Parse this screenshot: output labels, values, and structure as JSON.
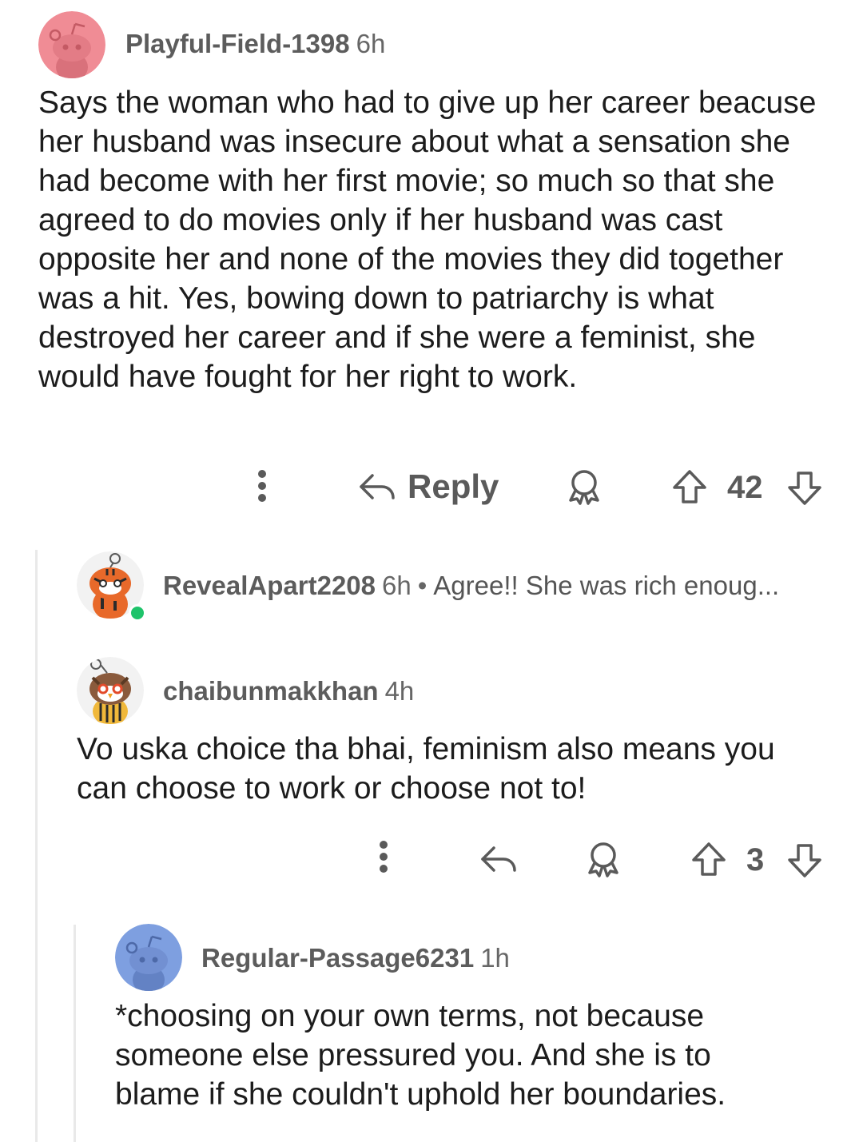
{
  "comments": [
    {
      "username": "Playful-Field-1398",
      "time": "6h",
      "avatar_icon": "snoo-avatar-pink",
      "body": "Says the woman who had to give up her career beacuse her husband was insecure about what a sensation she had become with her first movie; so much so that she agreed to do movies only if her husband was cast opposite her and none of the movies they did together was a hit. Yes, bowing down to patriarchy is what destroyed her career and if she were a feminist, she would have fought for her right to work.",
      "actions": {
        "more_icon": "more-vertical-icon",
        "reply_icon": "reply-arrow-icon",
        "reply_label": "Reply",
        "award_icon": "award-icon",
        "upvote_icon": "upvote-arrow-icon",
        "score": "42",
        "downvote_icon": "downvote-arrow-icon"
      }
    },
    {
      "username": "RevealApart2208",
      "time": "6h",
      "separator": "•",
      "preview": "Agree!! She was rich enoug...",
      "avatar_icon": "snoo-avatar-tiger",
      "online_color": "#1ec36a"
    },
    {
      "username": "chaibunmakkhan",
      "time": "4h",
      "avatar_icon": "snoo-avatar-owl",
      "body": "Vo uska choice tha bhai, feminism also means you can choose to work or choose not to!",
      "actions": {
        "more_icon": "more-vertical-icon",
        "reply_icon": "reply-arrow-icon",
        "award_icon": "award-icon",
        "upvote_icon": "upvote-arrow-icon",
        "score": "3",
        "downvote_icon": "downvote-arrow-icon"
      }
    },
    {
      "username": "Regular-Passage6231",
      "time": "1h",
      "avatar_icon": "snoo-avatar-blue",
      "body": "*choosing on your own terms, not because someone else pressured you. And she is to blame if she couldn't uphold her boundaries."
    }
  ],
  "colors": {
    "text": "#1c1c1c",
    "meta": "#5c5c5c",
    "icon": "#5a5a5a",
    "thread_line": "#e9e9e9",
    "avatar_pink": "#f08c95",
    "avatar_blue": "#7e9fe0"
  }
}
